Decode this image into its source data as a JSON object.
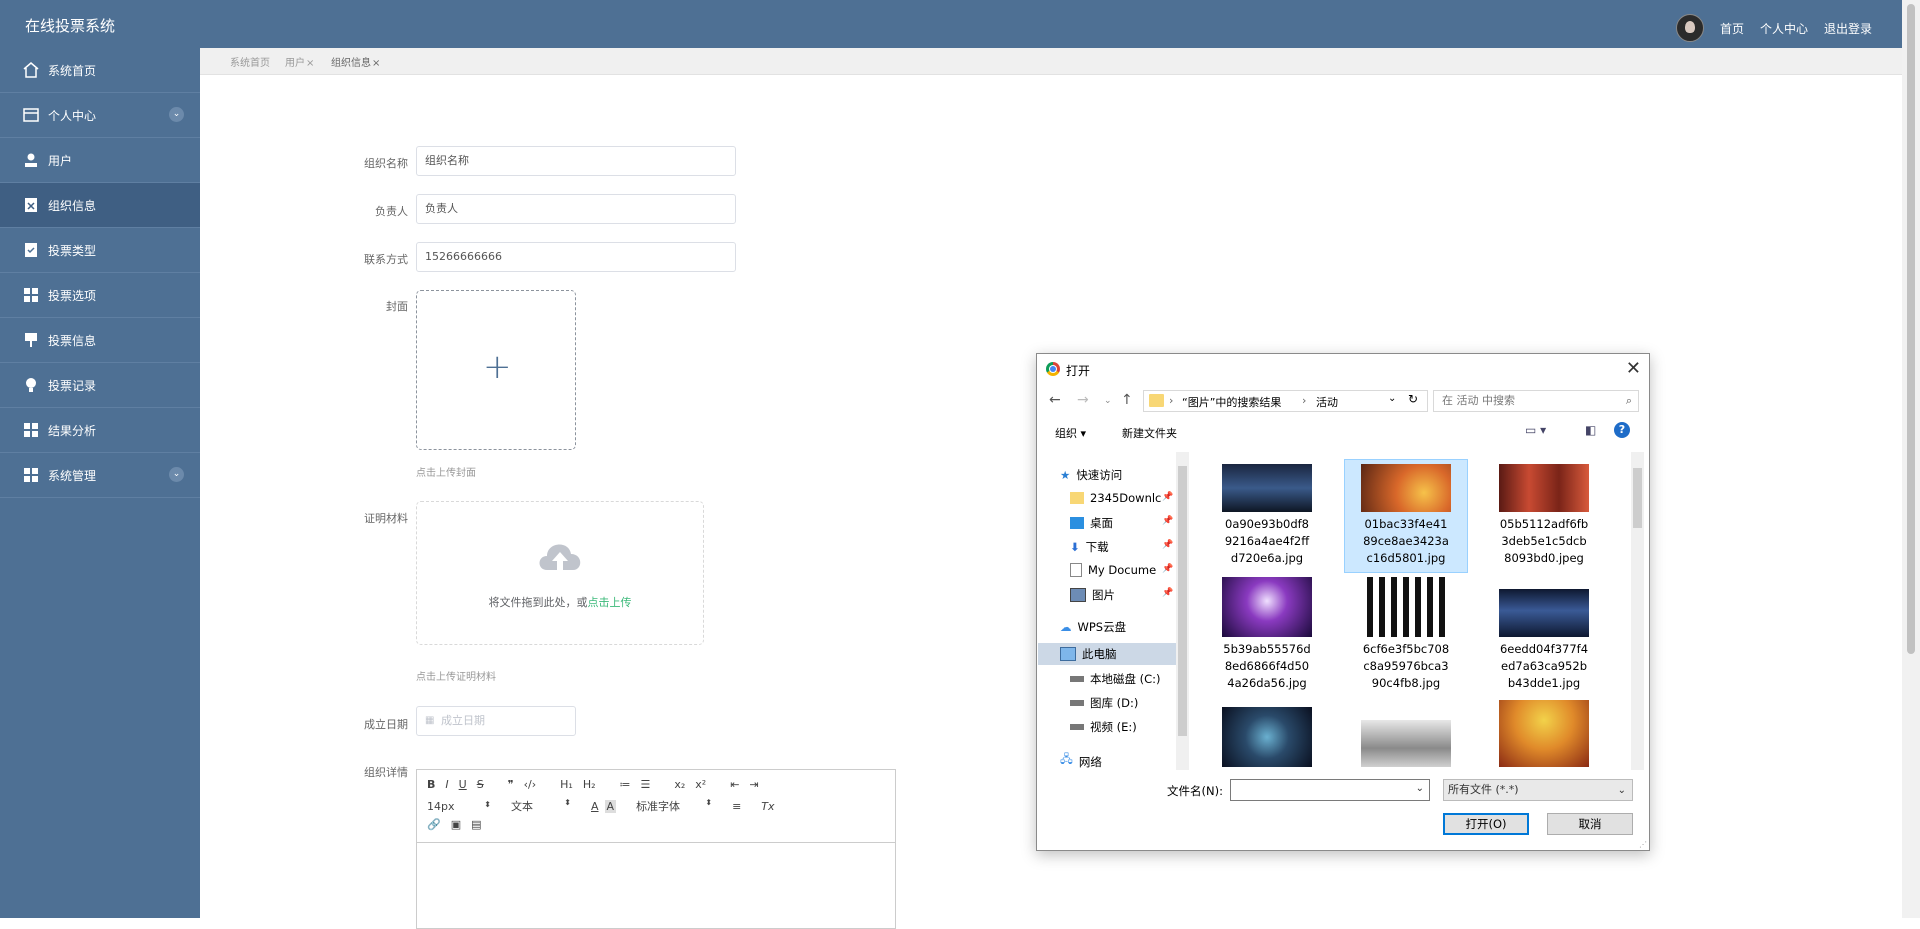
{
  "app": {
    "title": "在线投票系统"
  },
  "topnav": {
    "home": "首页",
    "profile": "个人中心",
    "logout": "退出登录"
  },
  "sidebar": {
    "items": [
      {
        "label": "系统首页"
      },
      {
        "label": "个人中心"
      },
      {
        "label": "用户"
      },
      {
        "label": "组织信息"
      },
      {
        "label": "投票类型"
      },
      {
        "label": "投票选项"
      },
      {
        "label": "投票信息"
      },
      {
        "label": "投票记录"
      },
      {
        "label": "结果分析"
      },
      {
        "label": "系统管理"
      }
    ]
  },
  "tabs": [
    {
      "label": "系统首页"
    },
    {
      "label": "用户"
    },
    {
      "label": "组织信息"
    }
  ],
  "form": {
    "org_name_label": "组织名称",
    "org_name_value": "组织名称",
    "leader_label": "负责人",
    "leader_value": "负责人",
    "contact_label": "联系方式",
    "contact_value": "15266666666",
    "cover_label": "封面",
    "cover_hint": "点击上传封面",
    "proof_label": "证明材料",
    "proof_drop_text": "将文件拖到此处，或",
    "proof_drop_link": "点击上传",
    "proof_hint": "点击上传证明材料",
    "date_label": "成立日期",
    "date_placeholder": "成立日期",
    "detail_label": "组织详情"
  },
  "editor": {
    "font_size": "14px",
    "block_type": "文本",
    "font_family": "标准字体"
  },
  "dialog": {
    "title": "打开",
    "path_part1": "“图片”中的搜索结果",
    "path_part2": "活动",
    "search_placeholder": "在 活动 中搜索",
    "organize": "组织",
    "new_folder": "新建文件夹",
    "tree": [
      {
        "label": "快速访问"
      },
      {
        "label": "2345Downlc"
      },
      {
        "label": "桌面"
      },
      {
        "label": "下载"
      },
      {
        "label": "My Docume"
      },
      {
        "label": "图片"
      },
      {
        "label": "WPS云盘"
      },
      {
        "label": "此电脑"
      },
      {
        "label": "本地磁盘 (C:)"
      },
      {
        "label": "图库 (D:)"
      },
      {
        "label": "视频 (E:)"
      },
      {
        "label": "网络"
      }
    ],
    "files": [
      {
        "name": "0a90e93b0df89216a4ae4f2ffd720e6a.jpg"
      },
      {
        "name": "01bac33f4e4189ce8ae3423ac16d5801.jpg"
      },
      {
        "name": "05b5112adf6fb3deb5e1c5dcb8093bd0.jpeg"
      },
      {
        "name": "5b39ab55576d8ed6866f4d504a26da56.jpg"
      },
      {
        "name": "6cf6e3f5bc708c8a95976bca390c4fb8.jpg"
      },
      {
        "name": "6eedd04f377f4ed7a63ca952bb43dde1.jpg"
      }
    ],
    "filename_label": "文件名(N):",
    "filetype_value": "所有文件 (*.*)",
    "open_button": "打开(O)",
    "cancel_button": "取消"
  }
}
